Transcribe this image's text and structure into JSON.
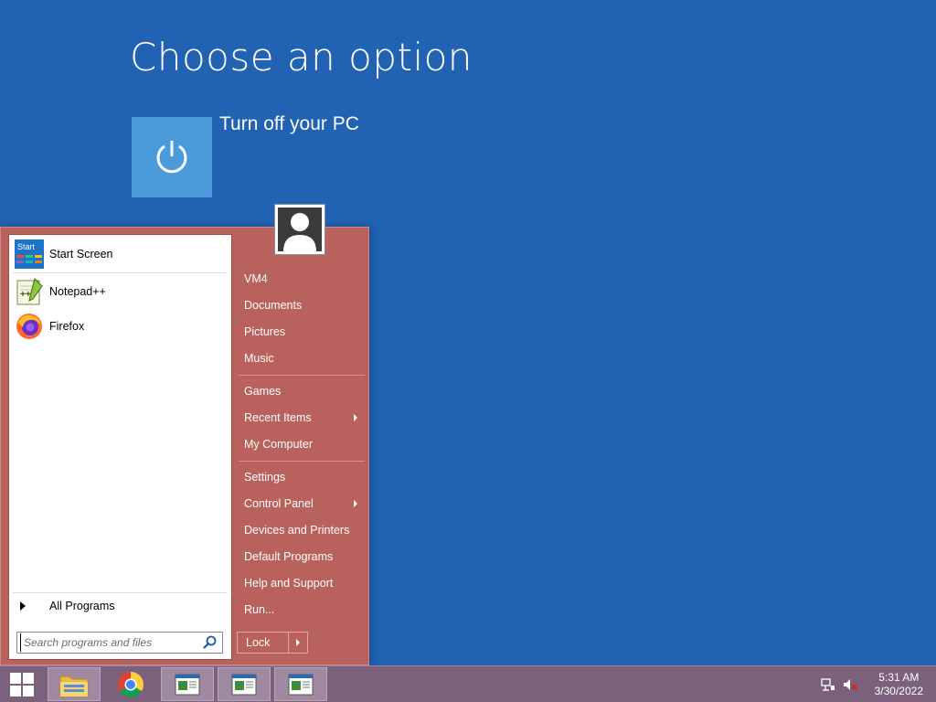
{
  "overlay": {
    "title": "Choose an option",
    "option_label": "Turn off your PC",
    "option_icon": "power-icon",
    "tile_color": "#4b9ad9",
    "background_color": "#2162b2"
  },
  "start_menu": {
    "accent_color": "#b9615c",
    "programs": [
      {
        "label": "Start Screen",
        "icon": "start-screen-icon"
      },
      {
        "label": "Notepad++",
        "icon": "notepadpp-icon"
      },
      {
        "label": "Firefox",
        "icon": "firefox-icon"
      }
    ],
    "all_programs_label": "All Programs",
    "search_placeholder": "Search programs and files",
    "right_items": [
      {
        "label": "VM4",
        "has_submenu": false
      },
      {
        "label": "Documents",
        "has_submenu": false
      },
      {
        "label": "Pictures",
        "has_submenu": false
      },
      {
        "label": "Music",
        "has_submenu": false
      },
      {
        "label": "Games",
        "has_submenu": false
      },
      {
        "label": "Recent Items",
        "has_submenu": true
      },
      {
        "label": "My Computer",
        "has_submenu": false
      },
      {
        "label": "Settings",
        "has_submenu": false
      },
      {
        "label": "Control Panel",
        "has_submenu": true
      },
      {
        "label": "Devices and Printers",
        "has_submenu": false
      },
      {
        "label": "Default Programs",
        "has_submenu": false
      },
      {
        "label": "Help and Support",
        "has_submenu": false
      },
      {
        "label": "Run...",
        "has_submenu": false
      }
    ],
    "lock_label": "Lock",
    "user_icon": "user-avatar-icon"
  },
  "taskbar": {
    "color": "#7c617d",
    "pinned": [
      {
        "name": "file-explorer-icon"
      },
      {
        "name": "chrome-icon"
      },
      {
        "name": "app-window-icon"
      },
      {
        "name": "app-window-icon"
      },
      {
        "name": "app-window-icon"
      }
    ],
    "clock_time": "5:31 AM",
    "clock_date": "3/30/2022",
    "tray_icons": [
      "network-icon",
      "volume-muted-icon"
    ]
  }
}
